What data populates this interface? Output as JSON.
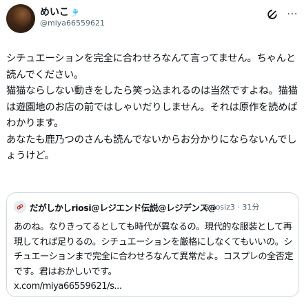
{
  "tweet": {
    "display_name": "めいこ",
    "name_emoji": "🎐",
    "handle": "@miya66559621",
    "body": "シチュエーションを完全に合わせろなんて言ってません。ちゃんと読んでください。\n猫猫ならしない動きをしたら笑っ込まれるのは当然ですよね。猫猫は遊園地のお店の前ではしゃいだりしません。それは原作を読めばわかります。\nあなたも鹿乃つのさんも読んでないからお分かりにならないんでしょうけど。"
  },
  "quote": {
    "name": "だがしかしriosi@レジエンド伝説@レジデンス@",
    "handle_time": "@riosiz3 · 31分",
    "text": "あのね。なりきってるとしても時代が異なるの。現代的な服装として再現してれば足りるの。シチュエーションを厳格にしなくてもいいの。シチュエーションまで完全に合わせろなんて異常だよ。コスプレの全否定です。君はおかしいです。",
    "link": "x.com/miya66559621/s..."
  },
  "icons": {
    "grok": "grok-icon",
    "more": "more-horizontal-icon",
    "chain": "chain-link-icon"
  }
}
